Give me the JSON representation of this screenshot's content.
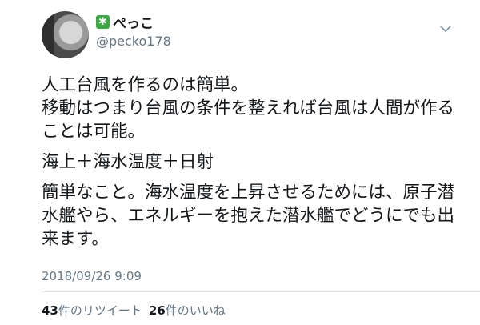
{
  "user": {
    "display_name": "ぺっこ",
    "handle": "@pecko178",
    "badge_icon": "green-star-badge-icon",
    "badge_color": "#3aa841"
  },
  "tweet": {
    "paragraphs": [
      "人工台風を作るのは簡単。",
      "移動はつまり台風の条件を整えれば台風は人間が作ることは可能。",
      "海上＋海水温度＋日射",
      "簡単なこと。海水温度を上昇させるためには、原子潜水艦やら、エネルギーを抱えた潜水艦でどうにでも出来ます。"
    ],
    "timestamp": "2018/09/26 9:09"
  },
  "stats": {
    "retweets_count": "43",
    "retweets_label": "件のリツイート",
    "likes_count": "26",
    "likes_label": "件のいいね"
  },
  "icons": {
    "menu": "chevron-down-icon"
  }
}
